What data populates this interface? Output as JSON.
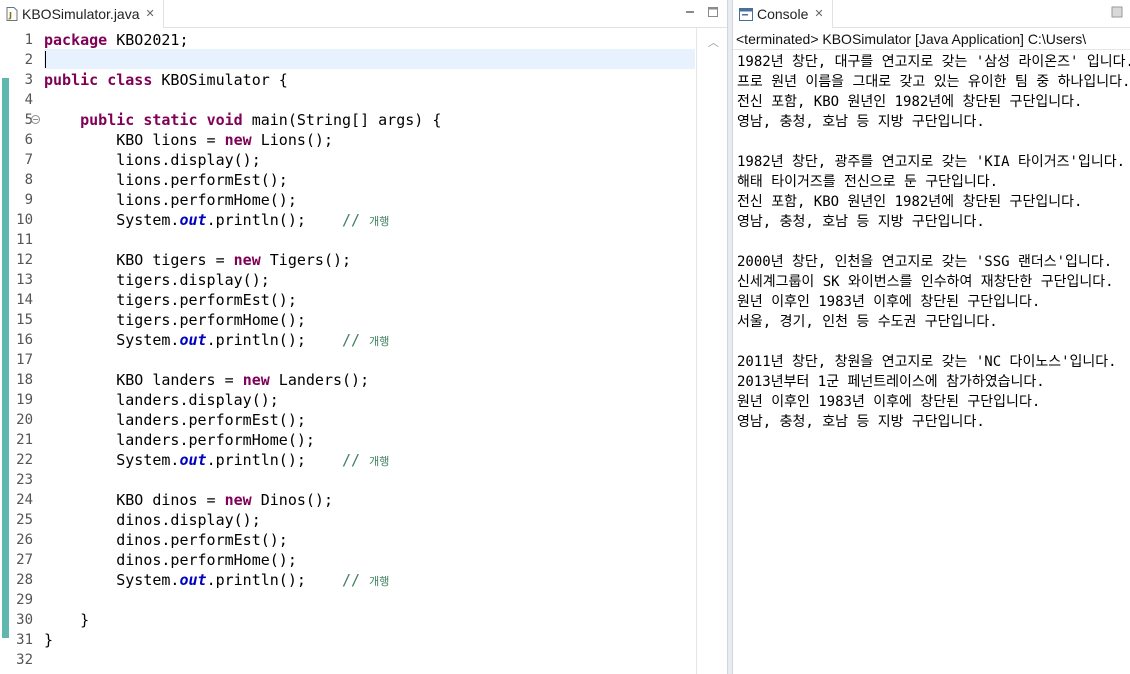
{
  "editor": {
    "tab_label": "KBOSimulator.java",
    "file_icon": "java-file-icon",
    "lines": [
      {
        "num": "1",
        "parts": [
          {
            "t": "package",
            "c": "kw"
          },
          {
            "t": " KBO2021;",
            "c": ""
          }
        ]
      },
      {
        "num": "2",
        "parts": []
      },
      {
        "num": "3",
        "parts": [
          {
            "t": "public",
            "c": "kw"
          },
          {
            "t": " ",
            "c": ""
          },
          {
            "t": "class",
            "c": "kw"
          },
          {
            "t": " KBOSimulator {",
            "c": ""
          }
        ]
      },
      {
        "num": "4",
        "parts": []
      },
      {
        "num": "5",
        "parts": [
          {
            "t": "    ",
            "c": ""
          },
          {
            "t": "public",
            "c": "kw"
          },
          {
            "t": " ",
            "c": ""
          },
          {
            "t": "static",
            "c": "kw"
          },
          {
            "t": " ",
            "c": ""
          },
          {
            "t": "void",
            "c": "kw"
          },
          {
            "t": " main(String[] args) {",
            "c": ""
          }
        ]
      },
      {
        "num": "6",
        "parts": [
          {
            "t": "        KBO lions = ",
            "c": ""
          },
          {
            "t": "new",
            "c": "kw"
          },
          {
            "t": " Lions();",
            "c": ""
          }
        ]
      },
      {
        "num": "7",
        "parts": [
          {
            "t": "        lions.display();",
            "c": ""
          }
        ]
      },
      {
        "num": "8",
        "parts": [
          {
            "t": "        lions.performEst();",
            "c": ""
          }
        ]
      },
      {
        "num": "9",
        "parts": [
          {
            "t": "        lions.performHome();",
            "c": ""
          }
        ]
      },
      {
        "num": "10",
        "parts": [
          {
            "t": "        System.",
            "c": ""
          },
          {
            "t": "out",
            "c": "fld"
          },
          {
            "t": ".println();    ",
            "c": ""
          },
          {
            "t": "// ",
            "c": "cmt"
          },
          {
            "t": "개행",
            "c": "cmt cmt-k"
          }
        ]
      },
      {
        "num": "11",
        "parts": []
      },
      {
        "num": "12",
        "parts": [
          {
            "t": "        KBO tigers = ",
            "c": ""
          },
          {
            "t": "new",
            "c": "kw"
          },
          {
            "t": " Tigers();",
            "c": ""
          }
        ]
      },
      {
        "num": "13",
        "parts": [
          {
            "t": "        tigers.display();",
            "c": ""
          }
        ]
      },
      {
        "num": "14",
        "parts": [
          {
            "t": "        tigers.performEst();",
            "c": ""
          }
        ]
      },
      {
        "num": "15",
        "parts": [
          {
            "t": "        tigers.performHome();",
            "c": ""
          }
        ]
      },
      {
        "num": "16",
        "parts": [
          {
            "t": "        System.",
            "c": ""
          },
          {
            "t": "out",
            "c": "fld"
          },
          {
            "t": ".println();    ",
            "c": ""
          },
          {
            "t": "// ",
            "c": "cmt"
          },
          {
            "t": "개행",
            "c": "cmt cmt-k"
          }
        ]
      },
      {
        "num": "17",
        "parts": []
      },
      {
        "num": "18",
        "parts": [
          {
            "t": "        KBO landers = ",
            "c": ""
          },
          {
            "t": "new",
            "c": "kw"
          },
          {
            "t": " Landers();",
            "c": ""
          }
        ]
      },
      {
        "num": "19",
        "parts": [
          {
            "t": "        landers.display();",
            "c": ""
          }
        ]
      },
      {
        "num": "20",
        "parts": [
          {
            "t": "        landers.performEst();",
            "c": ""
          }
        ]
      },
      {
        "num": "21",
        "parts": [
          {
            "t": "        landers.performHome();",
            "c": ""
          }
        ]
      },
      {
        "num": "22",
        "parts": [
          {
            "t": "        System.",
            "c": ""
          },
          {
            "t": "out",
            "c": "fld"
          },
          {
            "t": ".println();    ",
            "c": ""
          },
          {
            "t": "// ",
            "c": "cmt"
          },
          {
            "t": "개행",
            "c": "cmt cmt-k"
          }
        ]
      },
      {
        "num": "23",
        "parts": []
      },
      {
        "num": "24",
        "parts": [
          {
            "t": "        KBO dinos = ",
            "c": ""
          },
          {
            "t": "new",
            "c": "kw"
          },
          {
            "t": " Dinos();",
            "c": ""
          }
        ]
      },
      {
        "num": "25",
        "parts": [
          {
            "t": "        dinos.display();",
            "c": ""
          }
        ]
      },
      {
        "num": "26",
        "parts": [
          {
            "t": "        dinos.performEst();",
            "c": ""
          }
        ]
      },
      {
        "num": "27",
        "parts": [
          {
            "t": "        dinos.performHome();",
            "c": ""
          }
        ]
      },
      {
        "num": "28",
        "parts": [
          {
            "t": "        System.",
            "c": ""
          },
          {
            "t": "out",
            "c": "fld"
          },
          {
            "t": ".println();    ",
            "c": ""
          },
          {
            "t": "// ",
            "c": "cmt"
          },
          {
            "t": "개행",
            "c": "cmt cmt-k"
          }
        ]
      },
      {
        "num": "29",
        "parts": []
      },
      {
        "num": "30",
        "parts": [
          {
            "t": "    }",
            "c": ""
          }
        ]
      },
      {
        "num": "31",
        "parts": [
          {
            "t": "}",
            "c": ""
          }
        ]
      },
      {
        "num": "32",
        "parts": []
      }
    ]
  },
  "console": {
    "tab_label": "Console",
    "header": "<terminated> KBOSimulator [Java Application] C:\\Users\\",
    "lines": [
      "1982년 창단, 대구를 연고지로 갖는 '삼성 라이온즈' 입니다.",
      "프로 원년 이름을 그대로 갖고 있는 유이한 팀 중 하나입니다.",
      "전신 포함, KBO 원년인 1982년에 창단된 구단입니다.",
      "영남, 충청, 호남 등 지방 구단입니다.",
      "",
      "1982년 창단, 광주를 연고지로 갖는 'KIA 타이거즈'입니다.",
      "해태 타이거즈를 전신으로 둔 구단입니다.",
      "전신 포함, KBO 원년인 1982년에 창단된 구단입니다.",
      "영남, 충청, 호남 등 지방 구단입니다.",
      "",
      "2000년 창단, 인천을 연고지로 갖는 'SSG 랜더스'입니다.",
      "신세계그룹이 SK 와이번스를 인수하여 재창단한 구단입니다.",
      "원년 이후인 1983년 이후에 창단된 구단입니다.",
      "서울, 경기, 인천 등 수도권 구단입니다.",
      "",
      "2011년 창단, 창원을 연고지로 갖는 'NC 다이노스'입니다.",
      "2013년부터 1군 페넌트레이스에 참가하였습니다.",
      "원년 이후인 1983년 이후에 창단된 구단입니다.",
      "영남, 충청, 호남 등 지방 구단입니다."
    ]
  },
  "colors": {
    "keyword": "#7f0055",
    "field": "#0000c0",
    "comment": "#3f7f5f",
    "current_line": "#e8f2fe",
    "quick_diff": "#5fb8b0"
  }
}
